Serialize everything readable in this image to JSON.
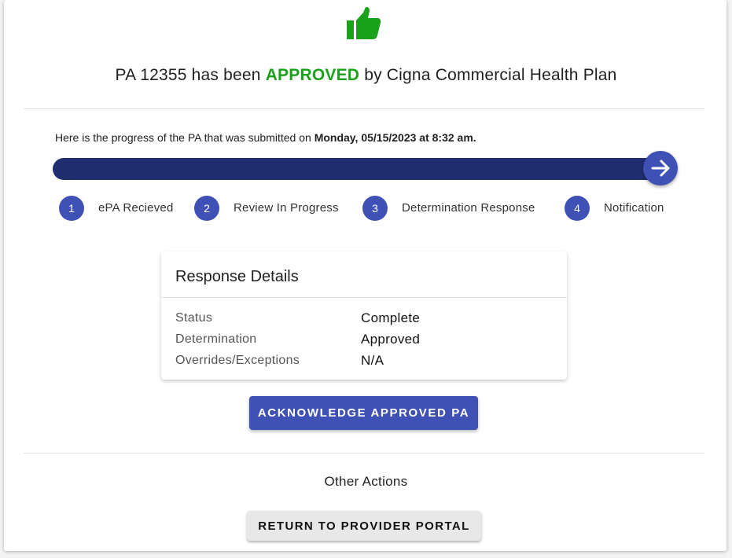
{
  "icons": {
    "header_icon": "thumbs-up-icon",
    "next_icon": "arrow-right-icon"
  },
  "colors": {
    "approved": "#1aa21a",
    "primary": "#3f51b5",
    "progress_bar": "#202e6f"
  },
  "header": {
    "prefix": "PA 12355  has been ",
    "status": "APPROVED",
    "suffix": " by Cigna Commercial Health Plan"
  },
  "progress": {
    "text_prefix": "Here is the progress of the PA that was submitted on ",
    "submitted_on": "Monday, 05/15/2023 at 8:32 am.",
    "steps": [
      {
        "number": "1",
        "label": "ePA Recieved"
      },
      {
        "number": "2",
        "label": "Review In Progress"
      },
      {
        "number": "3",
        "label": "Determination Response"
      },
      {
        "number": "4",
        "label": "Notification"
      }
    ]
  },
  "response_details": {
    "title": "Response Details",
    "rows": [
      {
        "label": "Status",
        "value": "Complete"
      },
      {
        "label": "Determination",
        "value": "Approved"
      },
      {
        "label": "Overrides/Exceptions",
        "value": "N/A"
      }
    ]
  },
  "actions": {
    "acknowledge_label": "ACKNOWLEDGE APPROVED PA",
    "other_actions_label": "Other Actions",
    "return_label": "RETURN TO PROVIDER PORTAL"
  }
}
